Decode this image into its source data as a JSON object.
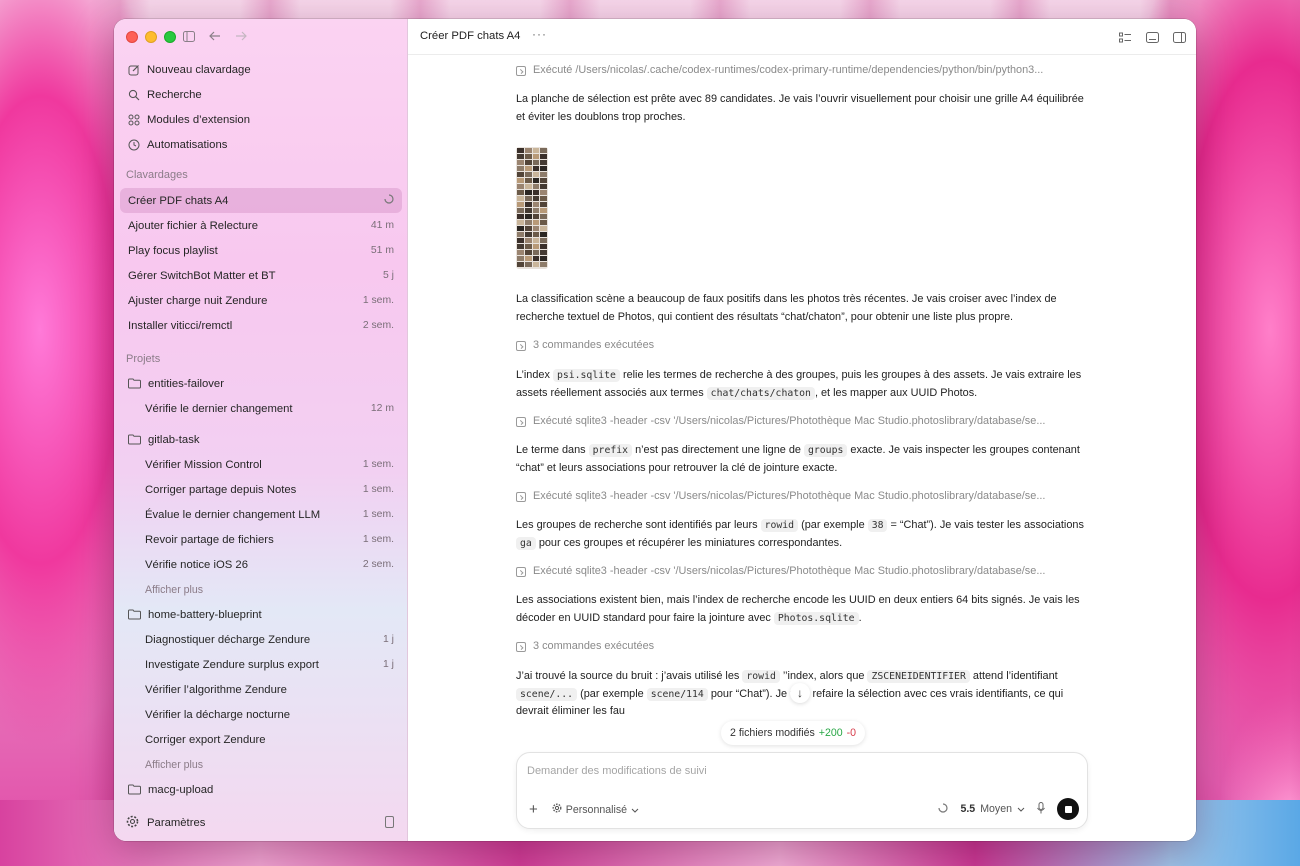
{
  "sidebar": {
    "nav": [
      {
        "label": "Nouveau clavardage",
        "icon": "edit-icon"
      },
      {
        "label": "Recherche",
        "icon": "search-icon"
      },
      {
        "label": "Modules d’extension",
        "icon": "grid-icon"
      },
      {
        "label": "Automatisations",
        "icon": "clock-icon"
      }
    ],
    "chats_title": "Clavardages",
    "chats": [
      {
        "label": "Créer PDF chats A4",
        "meta": ""
      },
      {
        "label": "Ajouter fichier à Relecture",
        "meta": "41 m"
      },
      {
        "label": "Play focus playlist",
        "meta": "51 m"
      },
      {
        "label": "Gérer SwitchBot Matter et BT",
        "meta": "5 j"
      },
      {
        "label": "Ajuster charge nuit Zendure",
        "meta": "1 sem."
      },
      {
        "label": "Installer viticci/remctl",
        "meta": "2 sem."
      }
    ],
    "projects_title": "Projets",
    "projects": [
      {
        "name": "entities-failover",
        "items": [
          {
            "label": "Vérifie le dernier changement",
            "meta": "12 m"
          }
        ]
      },
      {
        "name": "gitlab-task",
        "items": [
          {
            "label": "Vérifier Mission Control",
            "meta": "1 sem."
          },
          {
            "label": "Corriger partage depuis Notes",
            "meta": "1 sem."
          },
          {
            "label": "Évalue le dernier changement LLM",
            "meta": "1 sem."
          },
          {
            "label": "Revoir partage de fichiers",
            "meta": "1 sem."
          },
          {
            "label": "Vérifie notice iOS 26",
            "meta": "2 sem."
          }
        ],
        "show_more": "Afficher plus"
      },
      {
        "name": "home-battery-blueprint",
        "items": [
          {
            "label": "Diagnostiquer décharge Zendure",
            "meta": "1 j"
          },
          {
            "label": "Investigate Zendure surplus export",
            "meta": "1 j"
          },
          {
            "label": "Vérifier l’algorithme Zendure",
            "meta": ""
          },
          {
            "label": "Vérifier la décharge nocturne",
            "meta": ""
          },
          {
            "label": "Corriger export Zendure",
            "meta": ""
          }
        ],
        "show_more": "Afficher plus"
      },
      {
        "name": "macg-upload",
        "items": []
      }
    ],
    "settings_label": "Paramètres"
  },
  "main": {
    "title": "Créer PDF chats A4",
    "more": "···",
    "cmd1": "Exécuté /Users/nicolas/.cache/codex-runtimes/codex-primary-runtime/dependencies/python/bin/python3...",
    "p1": "La planche de sélection est prête avec 89 candidates. Je vais l’ouvrir visuellement pour choisir une grille A4 équilibrée et éviter les doublons trop proches.",
    "p2": "La classification scène a beaucoup de faux positifs dans les photos très récentes. Je vais croiser avec l’index de recherche textuel de Photos, qui contient des résultats “chat/chaton”, pour obtenir une liste plus propre.",
    "cmd2": "3 commandes exécutées",
    "p3a": "L’index ",
    "p3code1": "psi.sqlite",
    "p3b": " relie les termes de recherche à des groupes, puis les groupes à des assets. Je vais extraire les assets réellement associés aux termes ",
    "p3code2": "chat/chats/chaton",
    "p3c": ", et les mapper aux UUID Photos.",
    "cmd3": "Exécuté sqlite3 -header -csv '/Users/nicolas/Pictures/Photothèque Mac Studio.photoslibrary/database/se...",
    "p4a": "Le terme dans ",
    "p4code1": "prefix",
    "p4b": " n’est pas directement une ligne de ",
    "p4code2": "groups",
    "p4c": " exacte. Je vais inspecter les groupes contenant “chat” et leurs associations pour retrouver la clé de jointure exacte.",
    "cmd4": "Exécuté sqlite3 -header -csv '/Users/nicolas/Pictures/Photothèque Mac Studio.photoslibrary/database/se...",
    "p5a": "Les groupes de recherche sont identifiés par leurs ",
    "p5code1": "rowid",
    "p5b": " (par exemple ",
    "p5code2": "38",
    "p5c": " = “Chat”). Je vais tester les associations ",
    "p5code3": "ga",
    "p5d": " pour ces groupes et récupérer les miniatures correspondantes.",
    "cmd5": "Exécuté sqlite3 -header -csv '/Users/nicolas/Pictures/Photothèque Mac Studio.photoslibrary/database/se...",
    "p6a": "Les associations existent bien, mais l’index de recherche encode les UUID en deux entiers 64 bits signés. Je vais les décoder en UUID standard pour faire la jointure avec ",
    "p6code1": "Photos.sqlite",
    "p6b": ".",
    "cmd6": "3 commandes exécutées",
    "p7a": "J’ai trouvé la source du bruit : j’avais utilisé les ",
    "p7code1": "rowid",
    "p7b": " ’’index, alors que ",
    "p7code2": "ZSCENEIDENTIFIER",
    "p7c": " attend l’identifiant ",
    "p7code3": "scene/...",
    "p7d": " (par exemple ",
    "p7code4": "scene/114",
    "p7e": " pour “Chat”). Je vais refaire la sélection avec ces vrais identifiants, ce qui devrait éliminer les fau",
    "files_label": "2 fichiers modifiés",
    "files_add": "+200",
    "files_rem": "-0",
    "composer": {
      "placeholder": "Demander des modifications de suivi",
      "mode": "Personnalisé",
      "model": "5.5",
      "effort": "Moyen"
    }
  }
}
